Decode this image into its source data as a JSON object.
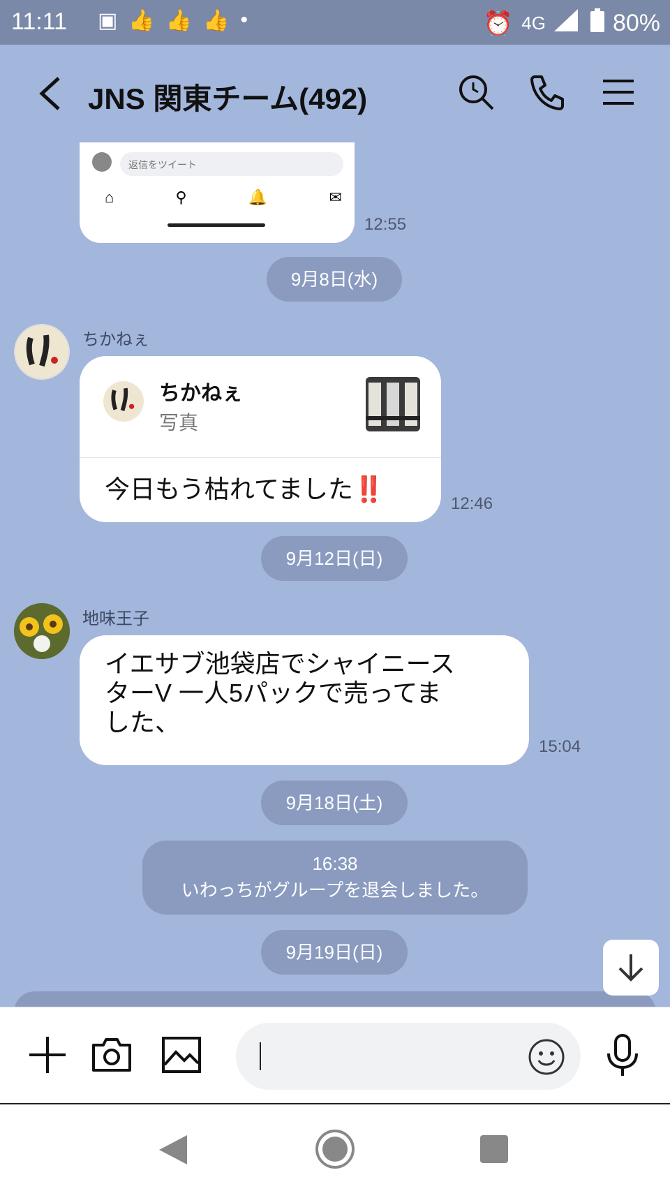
{
  "statusbar": {
    "time": "11:11",
    "network": "4G",
    "battery": "80%",
    "icons": [
      "image-icon",
      "thumbs-up-icon",
      "thumbs-up-icon",
      "thumbs-up-icon",
      "dot-icon",
      "alarm-icon",
      "signal-icon",
      "battery-icon"
    ]
  },
  "header": {
    "title": "JNS 関東チーム(492)"
  },
  "messages": {
    "first_ts": "12:55",
    "first_preview_placeholder": "返信をツイート",
    "date1": "9月8日(水)",
    "chika_name": "ちかねぇ",
    "chika_reply_name": "ちかねぇ",
    "chika_reply_type": "写真",
    "chika_text": "今日もう枯れてました‼️",
    "chika_ts": "12:46",
    "date2": "9月12日(日)",
    "jimi_name": "地味王子",
    "jimi_text_1": "イエサブ池袋店でシャイニース",
    "jimi_text_2": "ターV 一人5パックで売ってま",
    "jimi_text_3": "した、",
    "jimi_ts": "15:04",
    "date3": "9月18日(土)",
    "sys_time": "16:38",
    "sys_text": "いわっちがグループを退会しました。",
    "date4": "9月19日(日)"
  }
}
